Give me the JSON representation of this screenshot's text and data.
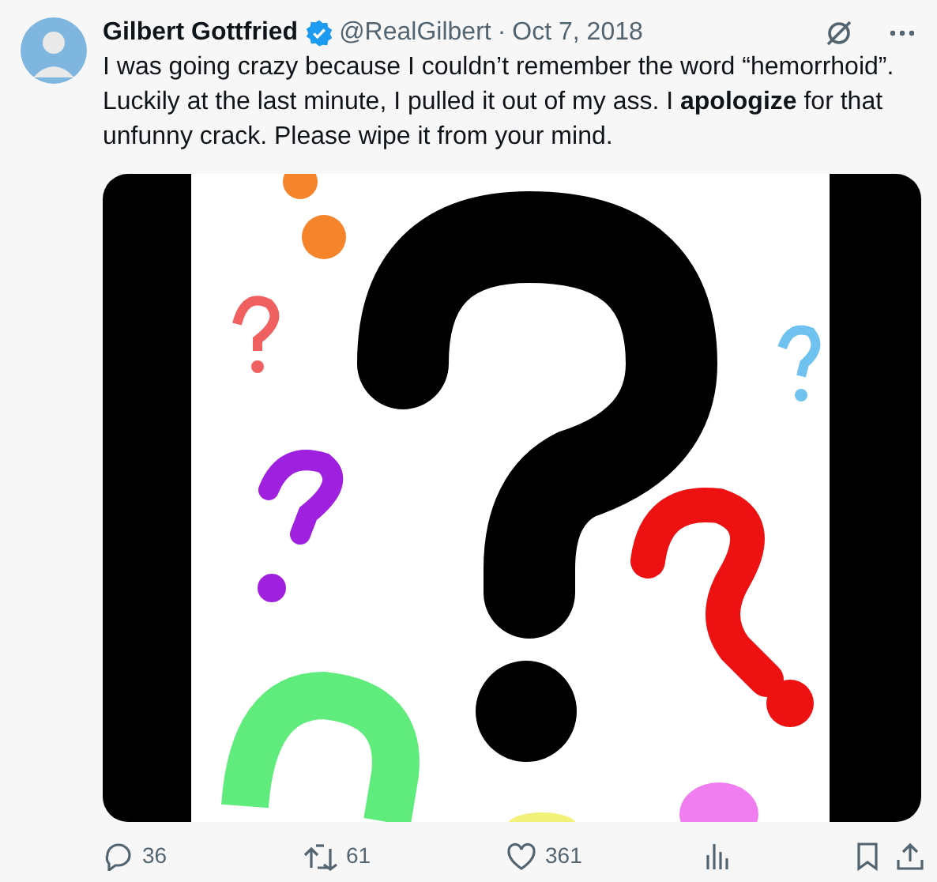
{
  "tweet": {
    "author": "Gilbert Gottfried",
    "verified": true,
    "handle": "@RealGilbert",
    "separator": "·",
    "date": "Oct 7, 2018",
    "text": "I was going crazy because I couldn’t remember the word “hemorrhoid”. Luckily at the last minute, I pulled it out of my ass. I **apologize** for that unfunny crack. Please wipe it from your mind.",
    "actions": [
      {
        "kind": "reply",
        "count": "36"
      },
      {
        "kind": "retweet",
        "count": "61"
      },
      {
        "kind": "like",
        "count": "361"
      },
      {
        "kind": "views"
      },
      {
        "kind": "bookmark"
      },
      {
        "kind": "share"
      }
    ]
  }
}
